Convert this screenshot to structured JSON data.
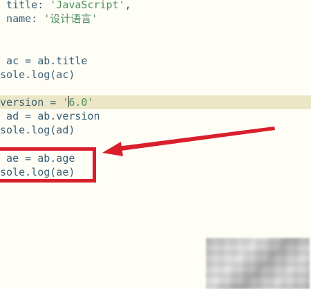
{
  "editor": {
    "lines": {
      "l1": {
        "pre": "  title: ",
        "str": "'JavaScript'",
        "post": ","
      },
      "l2": {
        "pre": "  name: ",
        "str": "'设计语言'",
        "post": ""
      },
      "l3": {
        "text": "t ac = ab.title"
      },
      "l4": {
        "text": "nsole.log(ac)"
      },
      "l5": {
        "pre": ".version = ",
        "str_a": "'",
        "str_b": "6.0'"
      },
      "l6": {
        "text": "t ad = ab.version"
      },
      "l7": {
        "text": "nsole.log(ad)"
      },
      "l8": {
        "text": "t ae = ab.age"
      },
      "l9": {
        "text": "nsole.log(ae)"
      }
    },
    "colors": {
      "background": "#fefdf6",
      "code": "#3a5f73",
      "string": "#4f8f62",
      "current_line": "#ebe7c6",
      "annotation": "#d91f2b"
    }
  },
  "annotation": {
    "shape": "red-rectangle-with-arrow",
    "arrow_icon": "red-arrow-icon"
  }
}
